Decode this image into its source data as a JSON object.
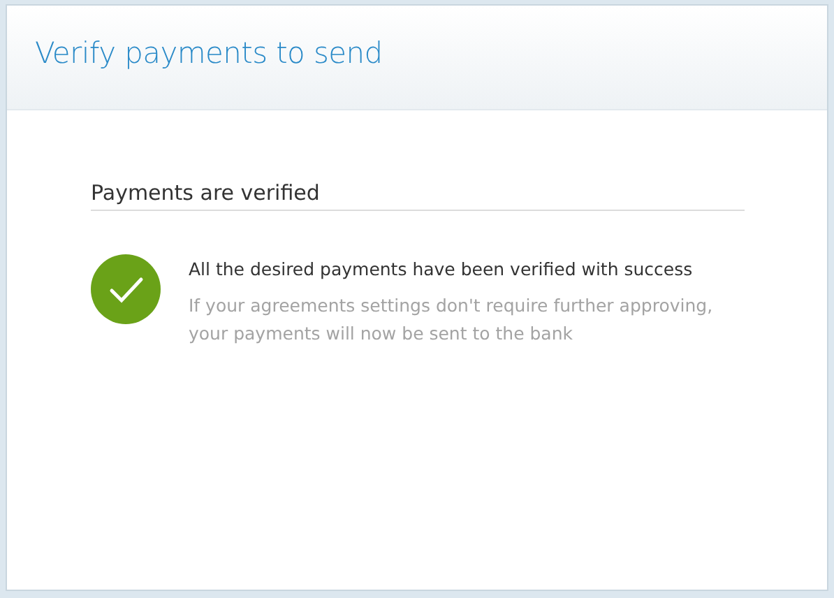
{
  "dialog": {
    "title": "Verify payments to send"
  },
  "section": {
    "heading": "Payments are verified"
  },
  "result": {
    "kind": "success",
    "message": "All the desired payments have been verified with success",
    "note": "If your agreements settings don't require further approving, your payments will now be sent to the bank"
  }
}
